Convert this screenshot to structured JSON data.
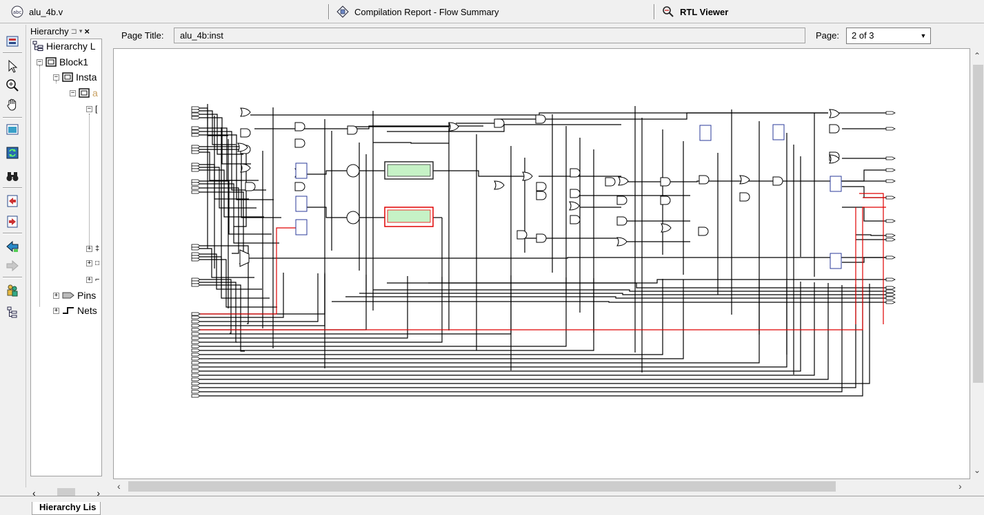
{
  "tabs": [
    {
      "label": "alu_4b.v",
      "icon": "verilog-file-icon"
    },
    {
      "label": "Compilation Report - Flow Summary",
      "icon": "report-icon"
    },
    {
      "label": "RTL Viewer",
      "icon": "rtl-viewer-icon"
    }
  ],
  "hierarchy": {
    "panel_title": "Hierarchy",
    "root_label": "Hierarchy L",
    "block_label": "Block1",
    "instances_label": "Insta",
    "instance_child": "a",
    "pins_label": "Pins",
    "nets_label": "Nets",
    "tab_label": "Hierarchy Lis"
  },
  "viewer": {
    "page_title_label": "Page Title:",
    "page_title_value": "alu_4b:inst",
    "page_label": "Page:",
    "page_value": "2 of 3"
  },
  "colors": {
    "wire": "#000000",
    "selected_wire": "#e00000",
    "label_text": "#9a2ea8",
    "block_fill": "#c6f2c6",
    "block_border": "#2a2a2a",
    "selected_border": "#e00000"
  }
}
